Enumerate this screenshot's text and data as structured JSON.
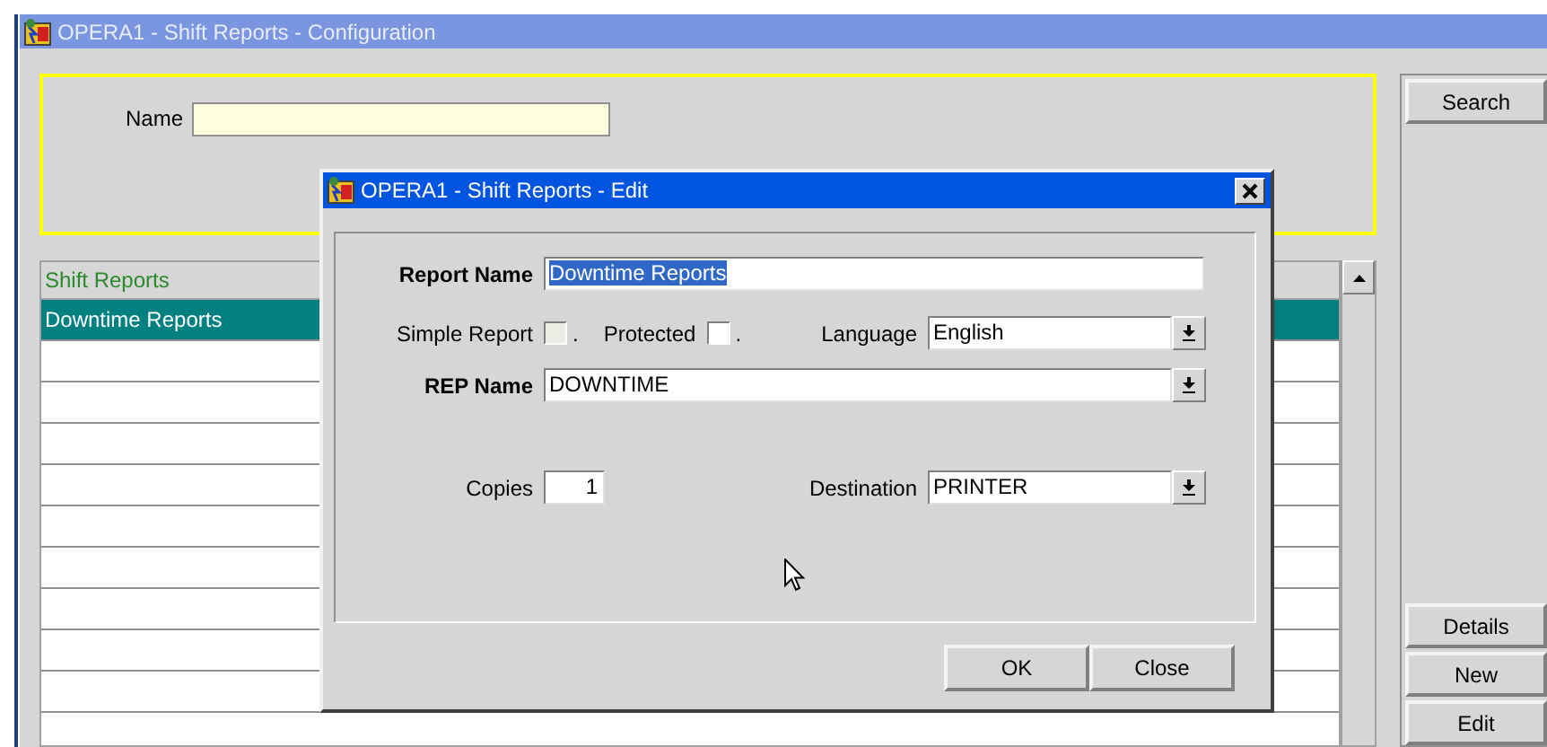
{
  "window": {
    "title": "OPERA1 - Shift Reports - Configuration"
  },
  "query": {
    "name_label": "Name"
  },
  "search_button": "Search",
  "list": {
    "header": "Shift Reports",
    "rows": [
      {
        "text": "Downtime Reports",
        "selected": true
      }
    ]
  },
  "side_buttons": [
    "Details",
    "New",
    "Edit"
  ],
  "dialog": {
    "title": "OPERA1 - Shift Reports - Edit",
    "report_name": {
      "label": "Report Name",
      "value": "Downtime Reports",
      "text_selected": true
    },
    "simple_report": {
      "label": "Simple Report",
      "checked": false,
      "disabled": true,
      "mark": "."
    },
    "protected": {
      "label": "Protected",
      "checked": false,
      "disabled": false,
      "mark": "."
    },
    "language": {
      "label": "Language",
      "value": "English"
    },
    "rep_name": {
      "label": "REP Name",
      "value": "DOWNTIME"
    },
    "copies": {
      "label": "Copies",
      "value": "1"
    },
    "destination": {
      "label": "Destination",
      "value": "PRINTER"
    },
    "buttons": [
      "OK",
      "Close"
    ]
  }
}
